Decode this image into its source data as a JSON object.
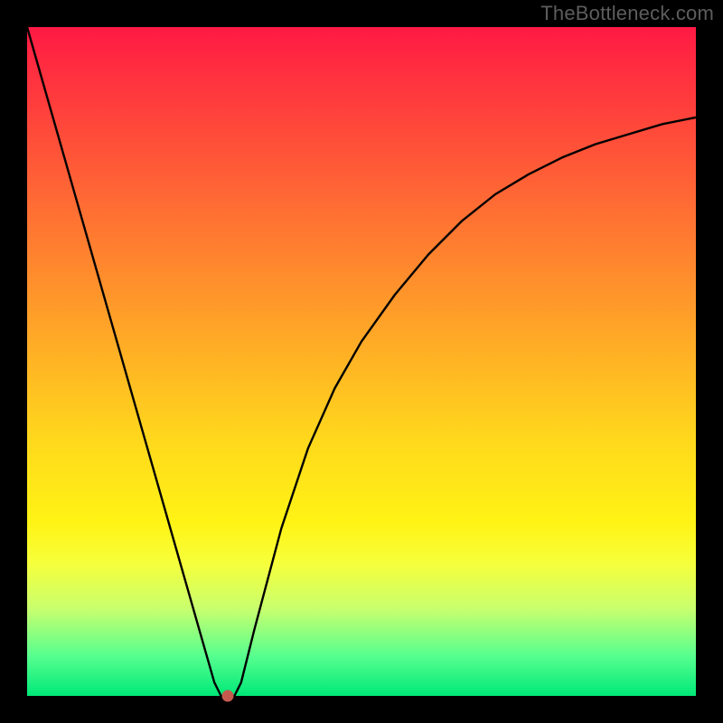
{
  "watermark": "TheBottleneck.com",
  "colors": {
    "frame": "#000000",
    "marker": "#c45a4d",
    "curve": "#000000",
    "gradient_top": "#ff1a44",
    "gradient_bottom": "#00e878"
  },
  "chart_data": {
    "type": "line",
    "title": "",
    "xlabel": "",
    "ylabel": "",
    "xlim": [
      0,
      100
    ],
    "ylim": [
      0,
      100
    ],
    "x": [
      0,
      4,
      8,
      12,
      16,
      20,
      24,
      26,
      28,
      29,
      30,
      31,
      32,
      34,
      38,
      42,
      46,
      50,
      55,
      60,
      65,
      70,
      75,
      80,
      85,
      90,
      95,
      100
    ],
    "values": [
      100,
      86,
      72,
      58,
      44,
      30,
      16,
      9,
      2,
      0,
      0,
      0,
      2,
      10,
      25,
      37,
      46,
      53,
      60,
      66,
      71,
      75,
      78,
      80.5,
      82.5,
      84,
      85.5,
      86.5
    ],
    "marker": {
      "x": 30,
      "y": 0
    },
    "series": [
      {
        "name": "bottleneck-curve",
        "x": [
          0,
          4,
          8,
          12,
          16,
          20,
          24,
          26,
          28,
          29,
          30,
          31,
          32,
          34,
          38,
          42,
          46,
          50,
          55,
          60,
          65,
          70,
          75,
          80,
          85,
          90,
          95,
          100
        ],
        "y": [
          100,
          86,
          72,
          58,
          44,
          30,
          16,
          9,
          2,
          0,
          0,
          0,
          2,
          10,
          25,
          37,
          46,
          53,
          60,
          66,
          71,
          75,
          78,
          80.5,
          82.5,
          84,
          85.5,
          86.5
        ]
      }
    ]
  }
}
